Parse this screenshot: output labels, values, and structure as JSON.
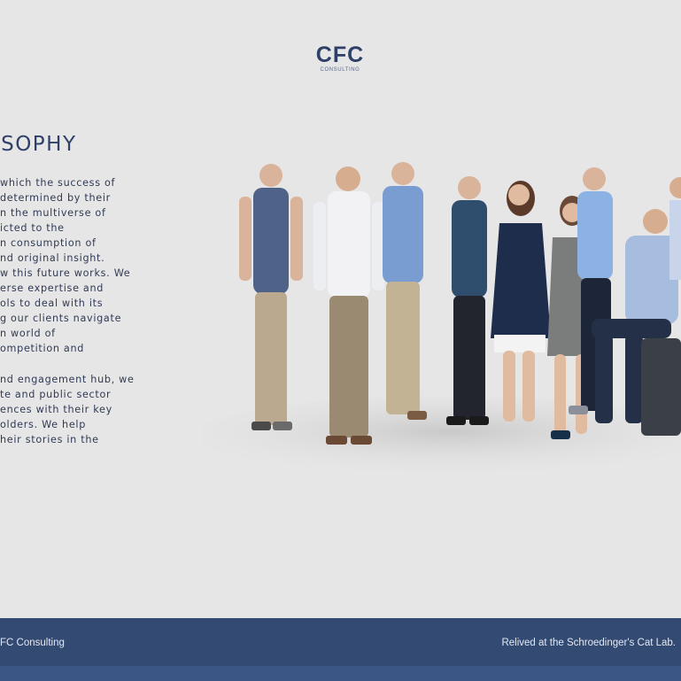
{
  "header": {
    "logo_mark": "CFC",
    "logo_sub": "CONSULTING"
  },
  "philosophy": {
    "title": "LOSOPHY",
    "paragraph1": [
      "which the success of",
      "determined by their",
      "n the multiverse of",
      "icted to the",
      "n consumption of",
      "nd original insight.",
      "w this future works. We",
      "erse expertise and",
      "ols to deal with its",
      "g our clients navigate",
      "n world of",
      "ompetition and"
    ],
    "paragraph2": [
      "nd engagement hub, we",
      "te and public sector",
      "ences with their key",
      "olders. We help",
      "heir stories in the"
    ]
  },
  "colors": {
    "background": "#e7e6e6",
    "footer": "#334a72",
    "footer_bottom": "#3b5685",
    "brand": "#2f4068"
  },
  "footer": {
    "left_text": "FC Consulting",
    "right_text": "Relived at the Schroedinger's Cat Lab."
  }
}
